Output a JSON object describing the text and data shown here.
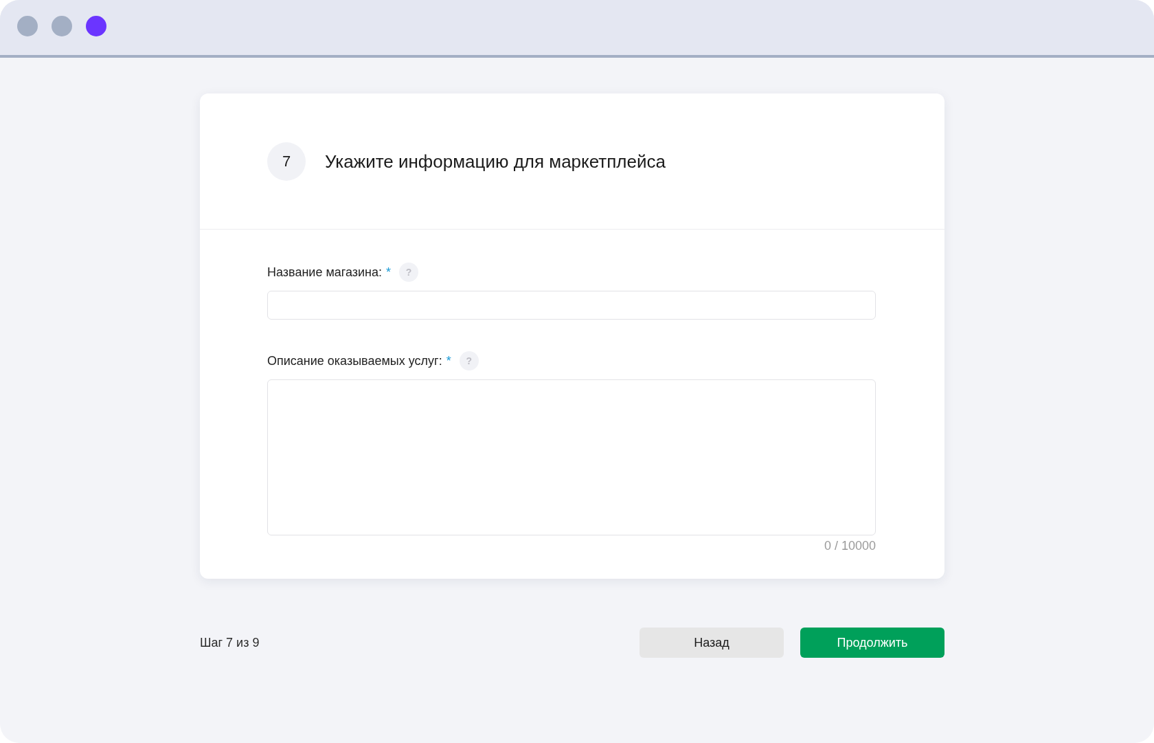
{
  "window": {
    "controls": [
      {
        "color": "#a3afc4"
      },
      {
        "color": "#a3afc4"
      },
      {
        "color": "#6b35ff"
      }
    ]
  },
  "form": {
    "step_number": "7",
    "title": "Укажите информацию для маркетплейса",
    "fields": [
      {
        "kind": "input",
        "label": "Название магазина:",
        "required_mark": "*",
        "help": "?"
      },
      {
        "kind": "textarea",
        "label": "Описание оказываемых услуг:",
        "required_mark": "*",
        "help": "?",
        "counter": "0 / 10000"
      }
    ]
  },
  "footer": {
    "step_text": "Шаг 7 из 9",
    "buttons": [
      {
        "kind": "secondary",
        "label": "Назад"
      },
      {
        "kind": "primary",
        "label": "Продолжить"
      }
    ]
  }
}
